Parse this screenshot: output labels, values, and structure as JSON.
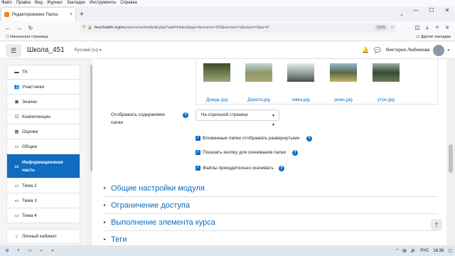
{
  "os_menu": [
    "Файл",
    "Правка",
    "Вид",
    "Журнал",
    "Закладки",
    "Инструменты",
    "Справка"
  ],
  "tab": {
    "title": "Редактирование Папка",
    "close": "×",
    "new": "+"
  },
  "window_controls": {
    "min": "—",
    "max": "☐",
    "close": "✕"
  },
  "nav": {
    "url_host": "beschetikh.myjino.ru",
    "url_path": "/course/modedit.php?add=folder&type=&course=155&section=1&return=0&sr=0",
    "zoom": "110%"
  },
  "bookmarks": {
    "start": "Начальная страница",
    "other": "Другие закладки"
  },
  "header": {
    "site_name": "Школа_451",
    "language": "Русский (ru)",
    "user_name": "Виктория Любимова"
  },
  "sidebar": {
    "items": [
      {
        "label": "ТК",
        "icon": "folder-icon"
      },
      {
        "label": "Участники",
        "icon": "users-icon"
      },
      {
        "label": "Значки",
        "icon": "badge-icon"
      },
      {
        "label": "Компетенции",
        "icon": "competency-icon"
      },
      {
        "label": "Оценки",
        "icon": "grades-icon"
      },
      {
        "label": "Общее",
        "icon": "folder-icon"
      },
      {
        "label": "Информационная часть",
        "icon": "folder-icon"
      },
      {
        "label": "Тема 2",
        "icon": "folder-icon"
      },
      {
        "label": "Тема 3",
        "icon": "folder-icon"
      },
      {
        "label": "Тема 4",
        "icon": "folder-icon"
      },
      {
        "label": "Личный кабинет",
        "icon": "dashboard-icon"
      }
    ]
  },
  "files": [
    {
      "name": "Дождь.jpg",
      "colors": [
        "#3d4a2c",
        "#6c7a4a",
        "#9aa67c"
      ]
    },
    {
      "name": "Дорога.jpg",
      "colors": [
        "#c8d4dc",
        "#8a9a6a",
        "#b0a070"
      ]
    },
    {
      "name": "зима.jpg",
      "colors": [
        "#e6ece8",
        "#9aa4a0",
        "#4a5048"
      ]
    },
    {
      "name": "рожь.jpg",
      "colors": [
        "#9ab8d0",
        "#5a6a48",
        "#c8b060"
      ]
    },
    {
      "name": "утро.jpg",
      "colors": [
        "#9ab0a0",
        "#3a4a38",
        "#6a7a5a"
      ]
    }
  ],
  "display": {
    "label_line1": "Отображать содержимое",
    "label_line2": "папки",
    "selected": "На отдельной странице"
  },
  "checkboxes": [
    {
      "label": "Вложенные папки отображать развернутыми",
      "checked": true
    },
    {
      "label": "Показать кнопку для скачивания папки",
      "checked": true
    },
    {
      "label": "Файлы принудительно скачивать",
      "checked": true
    }
  ],
  "sections": [
    "Общие настройки модуля",
    "Ограничение доступа",
    "Выполнение элемента курса",
    "Теги"
  ],
  "taskbar": {
    "lang": "РУС",
    "time": "16:36"
  },
  "colors": {
    "accent": "#0f6cbf"
  }
}
